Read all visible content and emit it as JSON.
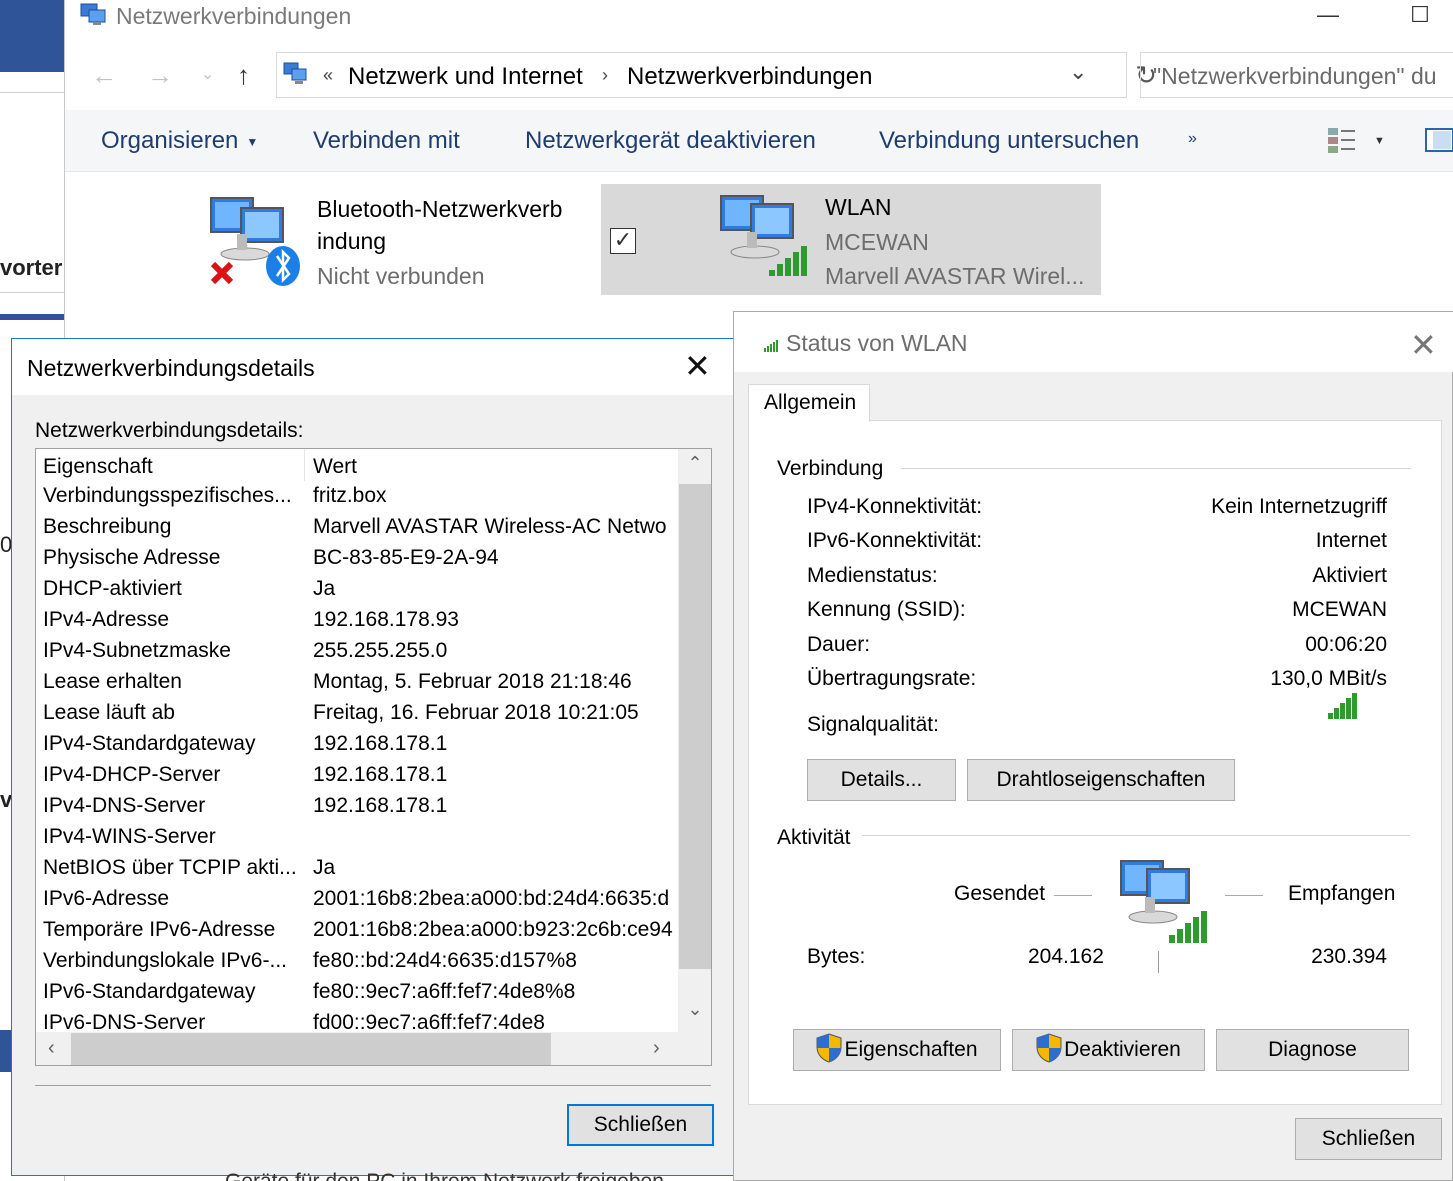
{
  "background": {
    "left_fragment_1": "vorter",
    "left_fragment_2": "0",
    "left_fragment_3": "v",
    "bottom_text": "Geräte für den PC in Ihrem Netzwerk freigeben"
  },
  "explorer": {
    "title": "Netzwerkverbindungen",
    "breadcrumb_overflow": "«",
    "breadcrumb": [
      "Netzwerk und Internet",
      "Netzwerkverbindungen"
    ],
    "breadcrumb_sep": "›",
    "search_placeholder": "\"Netzwerkverbindungen\" du",
    "commands": {
      "organize": "Organisieren",
      "connect": "Verbinden mit",
      "disable": "Netzwerkgerät deaktivieren",
      "diagnose": "Verbindung untersuchen",
      "more": "»"
    },
    "items": [
      {
        "name_line1": "Bluetooth-Netzwerkverb",
        "name_line2": "indung",
        "status": "Nicht verbunden"
      },
      {
        "name": "WLAN",
        "network": "MCEWAN",
        "adapter": "Marvell AVASTAR Wirel..."
      }
    ],
    "checkbox_mark": "✓"
  },
  "details_dialog": {
    "title": "Netzwerkverbindungsdetails",
    "caption": "Netzwerkverbindungsdetails:",
    "columns": {
      "property": "Eigenschaft",
      "value": "Wert"
    },
    "rows": [
      {
        "p": "Verbindungsspezifisches...",
        "v": "fritz.box"
      },
      {
        "p": "Beschreibung",
        "v": "Marvell AVASTAR Wireless-AC Netwo"
      },
      {
        "p": "Physische Adresse",
        "v": "BC-83-85-E9-2A-94"
      },
      {
        "p": "DHCP-aktiviert",
        "v": "Ja"
      },
      {
        "p": "IPv4-Adresse",
        "v": "192.168.178.93"
      },
      {
        "p": "IPv4-Subnetzmaske",
        "v": "255.255.255.0"
      },
      {
        "p": "Lease erhalten",
        "v": "Montag, 5. Februar 2018 21:18:46"
      },
      {
        "p": "Lease läuft ab",
        "v": "Freitag, 16. Februar 2018 10:21:05"
      },
      {
        "p": "IPv4-Standardgateway",
        "v": "192.168.178.1"
      },
      {
        "p": "IPv4-DHCP-Server",
        "v": "192.168.178.1"
      },
      {
        "p": "IPv4-DNS-Server",
        "v": "192.168.178.1"
      },
      {
        "p": "IPv4-WINS-Server",
        "v": ""
      },
      {
        "p": "NetBIOS über TCPIP akti...",
        "v": "Ja"
      },
      {
        "p": "IPv6-Adresse",
        "v": "2001:16b8:2bea:a000:bd:24d4:6635:d"
      },
      {
        "p": "Temporäre IPv6-Adresse",
        "v": "2001:16b8:2bea:a000:b923:2c6b:ce94"
      },
      {
        "p": "Verbindungslokale IPv6-...",
        "v": "fe80::bd:24d4:6635:d157%8"
      },
      {
        "p": "IPv6-Standardgateway",
        "v": "fe80::9ec7:a6ff:fef7:4de8%8"
      },
      {
        "p": "IPv6-DNS-Server",
        "v": "fd00::9ec7:a6ff:fef7:4de8"
      }
    ],
    "close_label": "Schließen"
  },
  "status_dialog": {
    "title": "Status von WLAN",
    "tab": "Allgemein",
    "connection_group": "Verbindung",
    "fields": [
      {
        "k": "IPv4-Konnektivität:",
        "v": "Kein Internetzugriff"
      },
      {
        "k": "IPv6-Konnektivität:",
        "v": "Internet"
      },
      {
        "k": "Medienstatus:",
        "v": "Aktiviert"
      },
      {
        "k": "Kennung (SSID):",
        "v": "MCEWAN"
      },
      {
        "k": "Dauer:",
        "v": "00:06:20"
      },
      {
        "k": "Übertragungsrate:",
        "v": "130,0 MBit/s"
      }
    ],
    "signal_label": "Signalqualität:",
    "signal_bars": 5,
    "details_button": "Details...",
    "wireless_button": "Drahtloseigenschaften",
    "activity_group": "Aktivität",
    "sent_label": "Gesendet",
    "received_label": "Empfangen",
    "bytes_label": "Bytes:",
    "bytes_sent": "204.162",
    "bytes_received": "230.394",
    "properties_button": "Eigenschaften",
    "disable_button": "Deaktivieren",
    "diagnose_button": "Diagnose",
    "close_label": "Schließen"
  }
}
